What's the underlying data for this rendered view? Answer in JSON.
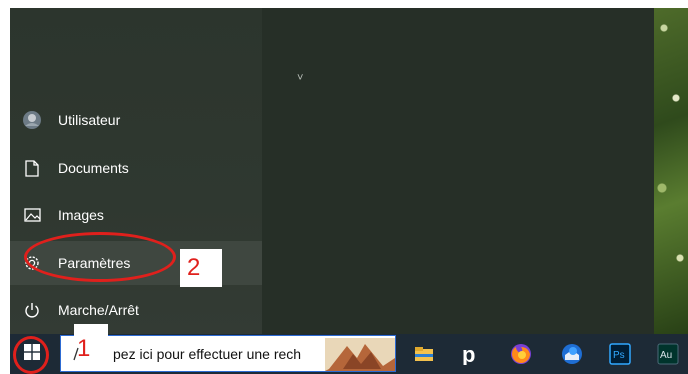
{
  "start_menu": {
    "items": [
      {
        "label": "Utilisateur",
        "icon": "user-avatar-icon"
      },
      {
        "label": "Documents",
        "icon": "document-icon"
      },
      {
        "label": "Images",
        "icon": "image-icon"
      },
      {
        "label": "Paramètres",
        "icon": "gear-icon"
      },
      {
        "label": "Marche/Arrêt",
        "icon": "power-icon"
      }
    ],
    "expand_chevron": "˅"
  },
  "taskbar": {
    "search_placeholder": "pez ici pour effectuer une rech",
    "apps": [
      {
        "name": "file-explorer-icon"
      },
      {
        "name": "pandora-p-icon",
        "label": "p"
      },
      {
        "name": "firefox-icon"
      },
      {
        "name": "thunderbird-icon"
      },
      {
        "name": "photoshop-icon",
        "label": "Ps"
      },
      {
        "name": "audition-icon",
        "label": "Au"
      }
    ]
  },
  "annotations": {
    "step_1": "1",
    "step_2": "2",
    "color": "#e0201c"
  },
  "colors": {
    "menu_bg": "#2c352d",
    "taskbar_bg": "#1d2a36",
    "search_border": "#2d6bd3"
  }
}
